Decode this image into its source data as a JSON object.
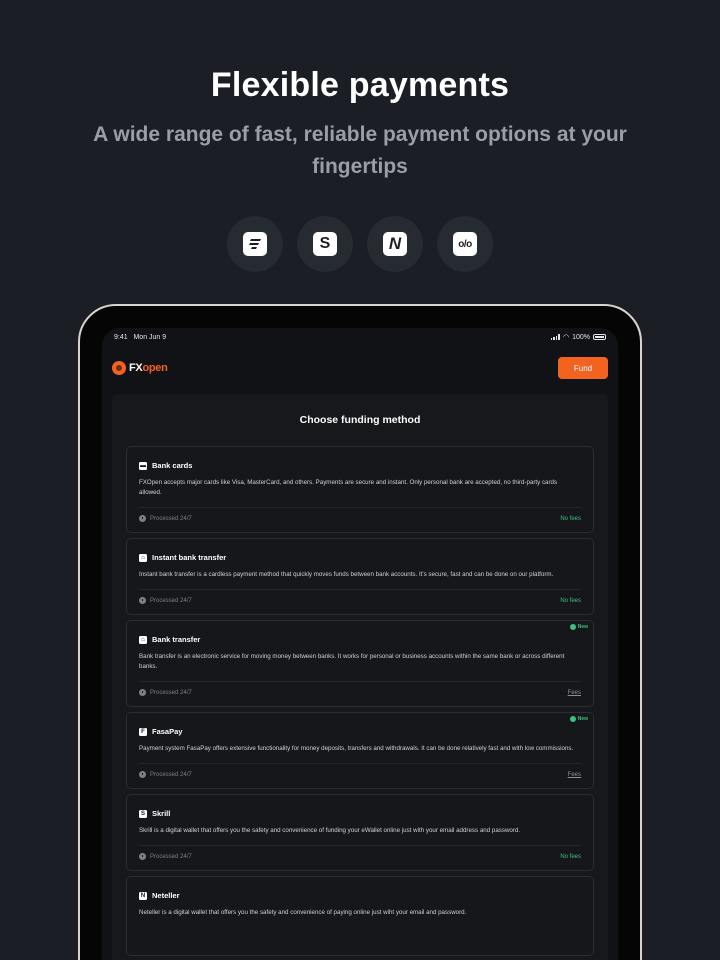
{
  "hero": {
    "title": "Flexible payments",
    "subtitle": "A wide range of fast, reliable payment options at your fingertips"
  },
  "payment_icons": [
    {
      "name": "fasapay-icon",
      "glyph": "≡"
    },
    {
      "name": "skrill-icon",
      "glyph": "S"
    },
    {
      "name": "neteller-icon",
      "glyph": "N"
    },
    {
      "name": "perfect-money-icon",
      "glyph": "o/o"
    }
  ],
  "device": {
    "status": {
      "time": "9:41",
      "date": "Mon Jun 9",
      "battery": "100%"
    },
    "app": {
      "logo_prefix": "FX",
      "logo_suffix": "open",
      "fund_label": "Fund",
      "panel_title": "Choose funding method",
      "methods": [
        {
          "icon": "card-icon",
          "glyph": "▬",
          "title": "Bank cards",
          "description": "FXOpen accepts major cards like Visa, MasterCard, and others. Payments are secure and instant. Only personal bank are accepted, no third-party cards allowed.",
          "processed": "Processed 24/7",
          "fee": "No fees",
          "fee_type": "nofee",
          "new": ""
        },
        {
          "icon": "bank-icon",
          "glyph": "⌂",
          "title": "Instant bank transfer",
          "description": "Instant bank transfer is a cardless payment method that quickly moves funds between bank accounts. It's secure, fast and can be done on our platform.",
          "processed": "Processed 24/7",
          "fee": "No fees",
          "fee_type": "nofee",
          "new": ""
        },
        {
          "icon": "bank-transfer-icon",
          "glyph": "⌂",
          "title": "Bank transfer",
          "description": "Bank transfer is an electronic service for moving money between banks. It works for personal or business accounts within the same bank or across different banks.",
          "processed": "Processed 24/7",
          "fee": "Fees",
          "fee_type": "fees",
          "new": "New"
        },
        {
          "icon": "fasapay-icon",
          "glyph": "F",
          "title": "FasaPay",
          "description": "Payment system FasaPay offers extensive functionality for money deposits, transfers and withdrawals. It can be done relatively fast and with low commissions.",
          "processed": "Processed 24/7",
          "fee": "Fees",
          "fee_type": "fees",
          "new": "New"
        },
        {
          "icon": "skrill-icon",
          "glyph": "S",
          "title": "Skrill",
          "description": "Skrill is a digital wallet that offers you the safety and convenience of funding your eWallet online just with your email address and password.",
          "processed": "Processed 24/7",
          "fee": "No fees",
          "fee_type": "nofee",
          "new": ""
        },
        {
          "icon": "neteller-icon",
          "glyph": "N",
          "title": "Neteller",
          "description": "Neteller is a digital wallet that offers you the safety and convenience of paying online just wiht your email and password.",
          "processed": "",
          "fee": "",
          "fee_type": "",
          "new": ""
        }
      ]
    }
  },
  "colors": {
    "accent": "#f26322",
    "success": "#3fbf7f",
    "background": "#1b1e24"
  }
}
